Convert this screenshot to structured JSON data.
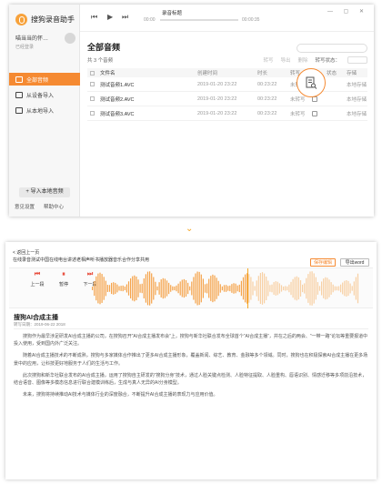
{
  "window": {
    "app_name": "搜狗录音助手",
    "user_name": "喵当当的怀…",
    "user_sub": "已经登录",
    "nav": [
      {
        "label": "全部音频",
        "active": true
      },
      {
        "label": "从设备导入",
        "active": false
      },
      {
        "label": "从本地导入",
        "active": false
      }
    ],
    "import_label": "+ 导入本地音频",
    "foot": [
      "意见设置",
      "帮助中心"
    ],
    "player": {
      "title": "录音标题",
      "cur": "00:00",
      "total": "00:00:35",
      "progress": 0.0
    }
  },
  "main": {
    "heading": "全部音频",
    "search_placeholder": "",
    "count": "共 3 个音频",
    "actions": [
      "转写",
      "导出",
      "删除"
    ],
    "sort_label": "转写状态：",
    "columns": [
      "文件名",
      "创建时间",
      "时长",
      "转写",
      "状态",
      "存储"
    ],
    "files": [
      {
        "name": "测试音频1.AVC",
        "sub": "",
        "time": "2019-01-20  23:22",
        "dur": "00:23:22",
        "status": "未转写",
        "save": "本地存储"
      },
      {
        "name": "测试音频2.AVC",
        "sub": "",
        "time": "2019-01-20  23:22",
        "dur": "00:23:22",
        "status": "未转写",
        "save": "本地存储"
      },
      {
        "name": "测试音频3.AVC",
        "sub": "",
        "time": "2019-01-20  23:22",
        "dur": "00:23:22",
        "status": "未转写",
        "save": "本地存储"
      }
    ]
  },
  "editor": {
    "back": "< 返回上一页",
    "subtitle": "在线录音测试中国在线电台讲述老相声听书播放器音乐合作分享共用",
    "save_label": "保存编辑",
    "export_label": "导出word",
    "controls": [
      "上一段",
      "暂停",
      "下一段"
    ],
    "doc_title": "搜狗AI合成主播",
    "doc_meta": "转写日期：2019-06-22  2018",
    "paragraphs": [
      "搜狗作为最早涉足研发AI合成主播的公司，在搜狗召开“AI合成主播发布会”上，搜狗与新华社联合发布全球首个“AI合成主播”，并在之后的两会、“一带一路”论坛等重要报道中投入使用，受到国内外广泛关注。",
      "随着AI合成主播技术的不断成熟，搜狗与多家媒体合作推出了更多AI合成主播形象，覆盖新闻、综艺、教育、金融等多个领域。同时，搜狗也在积极探索AI合成主播在更多场景中的应用，让科技更好地服务于人们的生活与工作。",
      "此次搜狗和新华社联合发布的AI合成主播，运用了搜狗自主研发的“搜狗分身”技术，通过人脸关键点检测、人脸特征提取、人脸重构、唇语识别、情感迁移等多项前沿技术，结合语音、图像等多模态信息进行联合建模训练后，生成与真人无异的AI分身模型。",
      "未来，搜狗将持续推动AI技术与媒体行业的深度融合，不断提升AI合成主播的表现力与应用价值。"
    ]
  }
}
